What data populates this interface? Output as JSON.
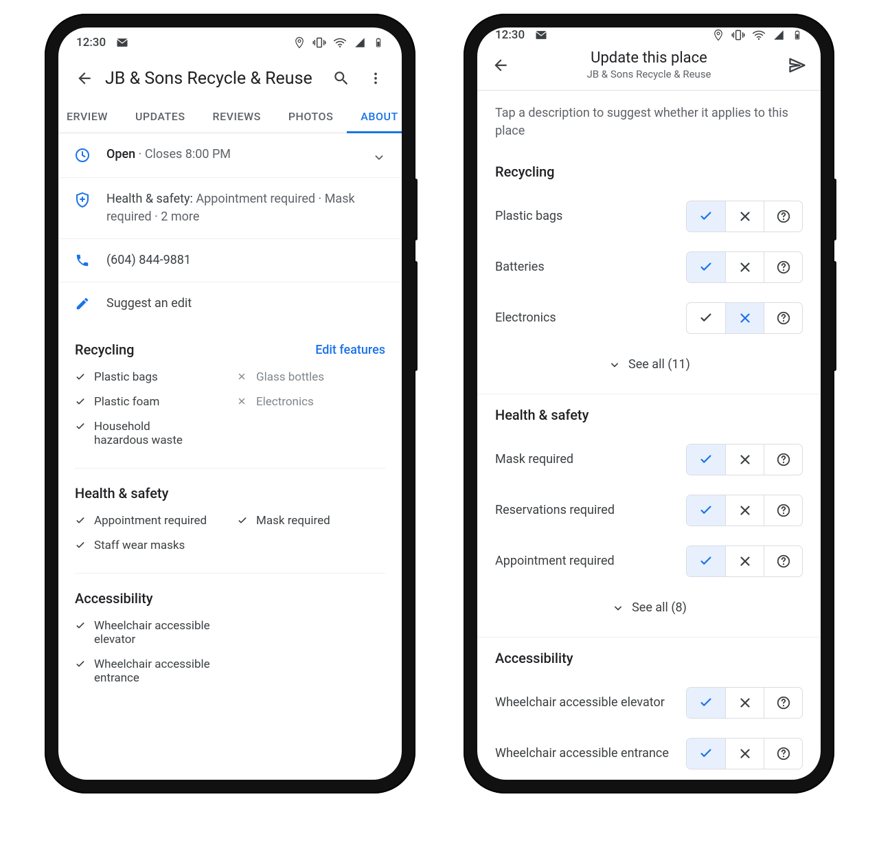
{
  "statusbar": {
    "time": "12:30"
  },
  "left": {
    "title": "JB & Sons Recycle & Reuse",
    "tabs": [
      "ERVIEW",
      "UPDATES",
      "REVIEWS",
      "PHOTOS",
      "ABOUT"
    ],
    "active_tab": 4,
    "hours": {
      "status": "Open",
      "closes": "Closes 8:00 PM"
    },
    "health": {
      "label": "Health & safety:",
      "text": "Appointment required · Mask required · 2 more"
    },
    "phone": "(604) 844-9881",
    "suggest": "Suggest an edit",
    "recycling": {
      "title": "Recycling",
      "edit": "Edit features",
      "yes": [
        "Plastic bags",
        "Plastic foam",
        "Household hazardous waste"
      ],
      "no": [
        "Glass bottles",
        "Electronics"
      ]
    },
    "health_safety": {
      "title": "Health & safety",
      "yes_left": [
        "Appointment required",
        "Staff wear masks"
      ],
      "yes_right": [
        "Mask required"
      ]
    },
    "accessibility": {
      "title": "Accessibility",
      "yes": [
        "Wheelchair accessible elevator",
        "Wheelchair accessible entrance"
      ]
    }
  },
  "right": {
    "title": "Update this place",
    "subtitle": "JB & Sons Recycle & Reuse",
    "hint": "Tap a description to suggest whether it applies to this place",
    "sections": [
      {
        "title": "Recycling",
        "items": [
          {
            "label": "Plastic bags",
            "sel": "yes"
          },
          {
            "label": "Batteries",
            "sel": "yes"
          },
          {
            "label": "Electronics",
            "sel": "no"
          }
        ],
        "see_all": "See all (11)"
      },
      {
        "title": "Health & safety",
        "items": [
          {
            "label": "Mask required",
            "sel": "yes"
          },
          {
            "label": "Reservations required",
            "sel": "yes"
          },
          {
            "label": "Appointment required",
            "sel": "yes"
          }
        ],
        "see_all": "See all (8)"
      },
      {
        "title": "Accessibility",
        "items": [
          {
            "label": "Wheelchair accessible elevator",
            "sel": "yes"
          },
          {
            "label": "Wheelchair accessible entrance",
            "sel": "yes"
          }
        ]
      }
    ]
  }
}
